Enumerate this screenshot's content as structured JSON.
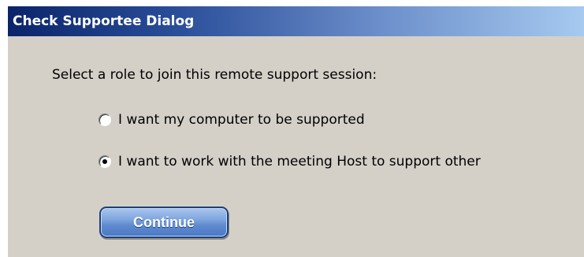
{
  "dialog": {
    "title": "Check Supportee Dialog",
    "prompt": "Select a role to join this remote support session:",
    "options": [
      {
        "label": "I want my computer to be supported",
        "checked": false
      },
      {
        "label": "I want to work with the meeting Host to support other",
        "checked": true
      }
    ],
    "continue_label": "Continue"
  },
  "colors": {
    "titlebar_start": "#0a246a",
    "titlebar_end": "#a6caf0",
    "dialog_background": "#d4d0c8",
    "button_blue": "#5f8bd0"
  }
}
